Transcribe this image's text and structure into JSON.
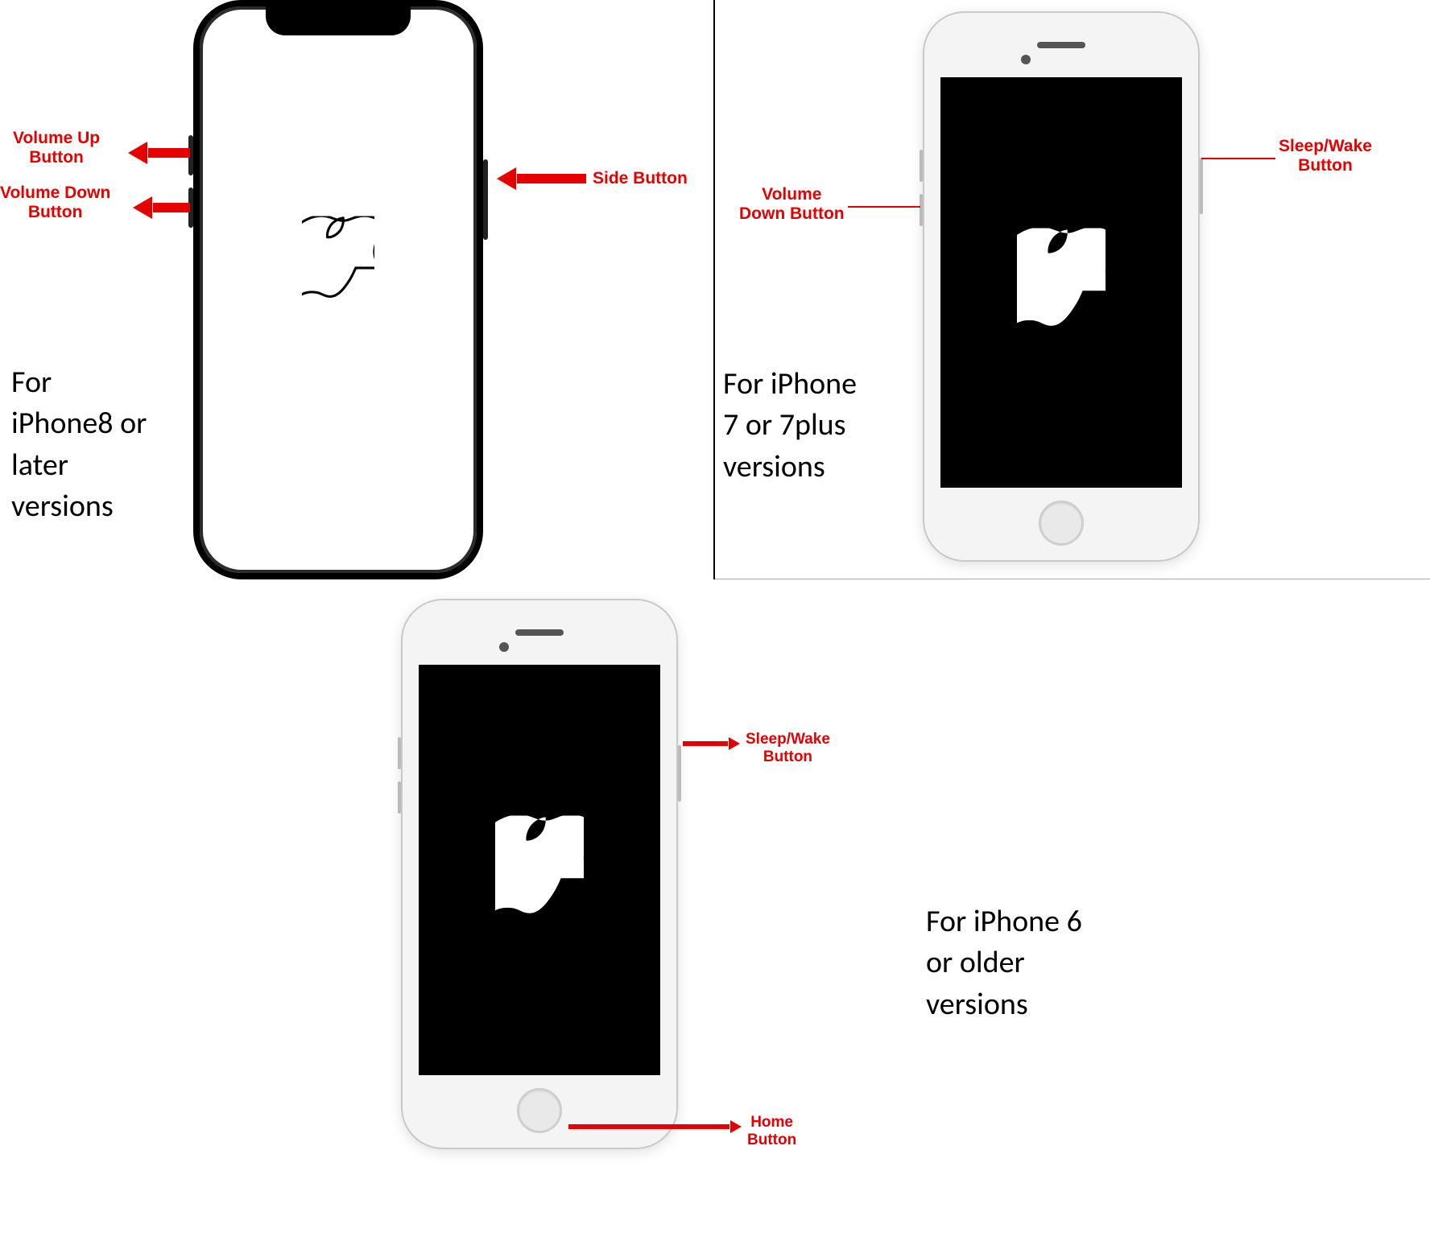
{
  "colors": {
    "label": "#e60000"
  },
  "panel1": {
    "caption": "For\niPhone8 or\nlater\nversions",
    "labels": {
      "volume_up": "Volume Up\nButton",
      "volume_down": "Volume Down\nButton",
      "side": "Side Button"
    }
  },
  "panel2": {
    "caption": "For iPhone\n7 or 7plus\nversions",
    "labels": {
      "volume_down": "Volume\nDown Button",
      "sleep_wake": "Sleep/Wake\nButton"
    }
  },
  "panel3": {
    "caption": "For iPhone 6\nor older\nversions",
    "labels": {
      "sleep_wake": "Sleep/Wake\nButton",
      "home": "Home\nButton"
    }
  }
}
